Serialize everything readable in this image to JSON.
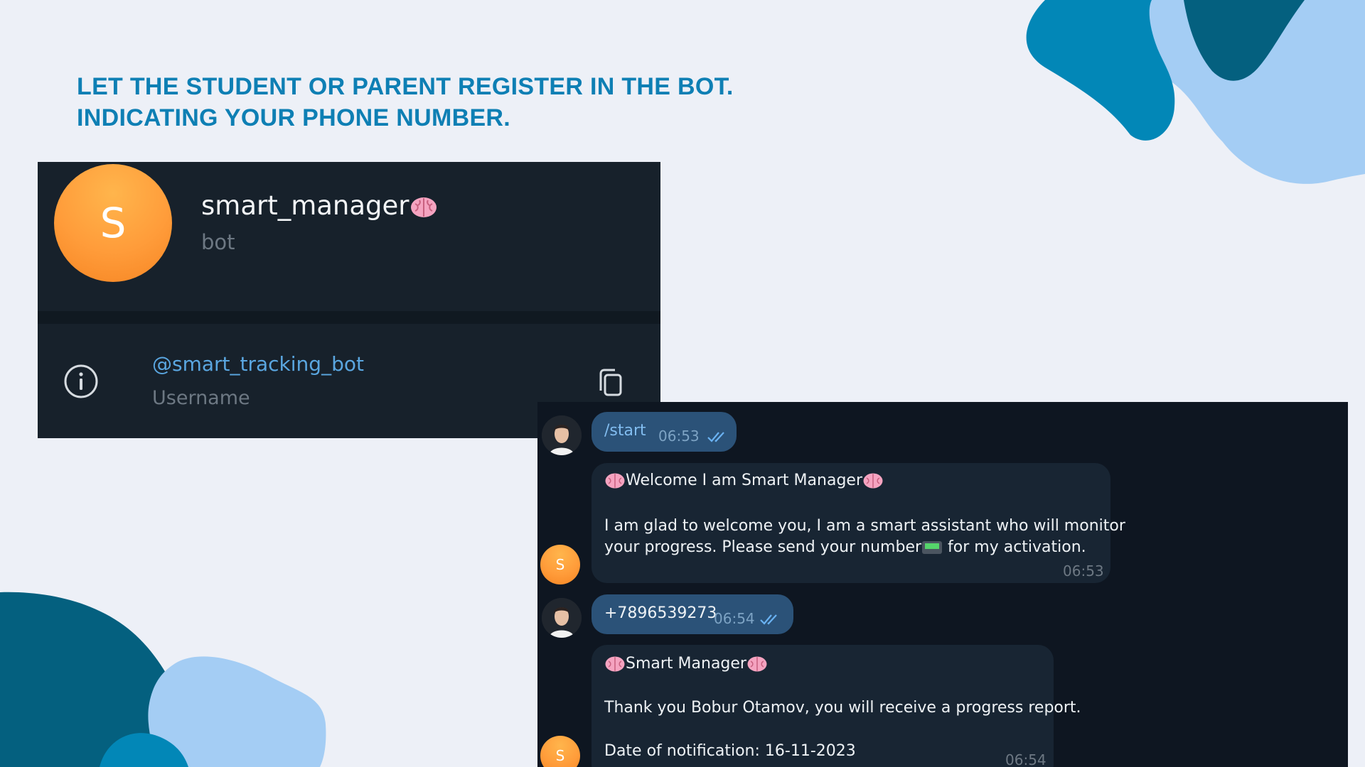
{
  "headline": {
    "line1": "LET THE STUDENT OR PARENT REGISTER IN THE BOT.",
    "line2": "INDICATING YOUR PHONE NUMBER."
  },
  "profile": {
    "avatar_letter": "S",
    "name": "smart_manager",
    "subtitle": "bot",
    "username": "@smart_tracking_bot",
    "username_label": "Username"
  },
  "chat": {
    "bot_avatar_letter": "S",
    "messages": [
      {
        "from": "user",
        "text": "/start",
        "time": "06:53",
        "status": "read"
      },
      {
        "from": "bot",
        "title": "Welcome I am Smart Manager",
        "line1": "I am glad to welcome you, I am a smart assistant who will monitor",
        "line2a": "your progress. Please send your number",
        "line2b": " for my activation.",
        "time": "06:53"
      },
      {
        "from": "user",
        "text": "+7896539273",
        "time": "06:54",
        "status": "read"
      },
      {
        "from": "bot",
        "title": "Smart Manager",
        "line1": "Thank you Bobur Otamov, you will receive a progress report.",
        "line2": "Date of notification: 16-11-2023",
        "time": "06:54"
      }
    ]
  },
  "colors": {
    "background": "#edf0f7",
    "headline": "#0e7fb4",
    "panel": "#17212b",
    "chat_bg": "#0e1621",
    "outgoing_bubble": "#2b5278",
    "incoming_bubble": "#182533",
    "link": "#5aa6e0",
    "avatar_orange": "#ff9c3a"
  },
  "icons": [
    "brain-emoji-icon",
    "info-icon",
    "copy-icon",
    "pager-emoji-icon",
    "double-check-icon"
  ]
}
